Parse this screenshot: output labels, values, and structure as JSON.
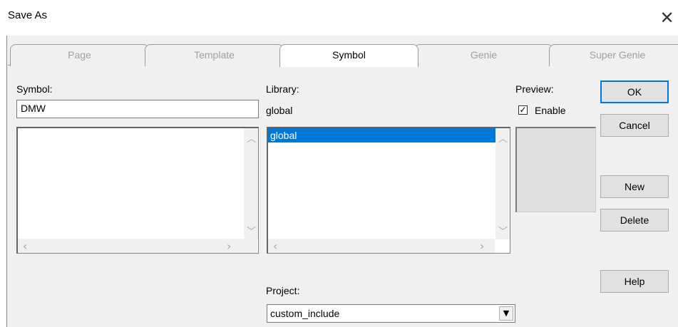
{
  "window": {
    "title": "Save As",
    "close_glyph": "✕"
  },
  "tabs": [
    {
      "label": "Page",
      "active": false
    },
    {
      "label": "Template",
      "active": false
    },
    {
      "label": "Symbol",
      "active": true
    },
    {
      "label": "Genie",
      "active": false
    },
    {
      "label": "Super Genie",
      "active": false
    }
  ],
  "symbol": {
    "label": "Symbol:",
    "value": "DMW",
    "list_items": []
  },
  "library": {
    "label": "Library:",
    "current": "global",
    "list_items": [
      "global"
    ],
    "selected": "global"
  },
  "preview": {
    "label": "Preview:",
    "enable_label": "Enable",
    "enable_checked": true
  },
  "project": {
    "label": "Project:",
    "value": "custom_include"
  },
  "buttons": {
    "ok": "OK",
    "cancel": "Cancel",
    "new": "New",
    "delete": "Delete",
    "help": "Help"
  },
  "glyphs": {
    "check": "✓",
    "up": "︿",
    "down": "﹀",
    "left": "‹",
    "right": "›",
    "dropdown": "▼"
  }
}
